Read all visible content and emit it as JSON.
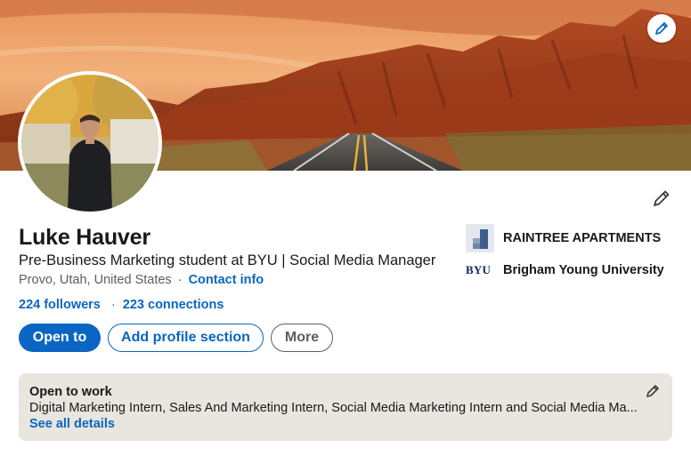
{
  "profile": {
    "name": "Luke Hauver",
    "headline": "Pre-Business Marketing student at BYU | Social Media Manager",
    "location": "Provo, Utah, United States",
    "location_separator": "·",
    "contact_info_label": "Contact info",
    "followers_label": "224 followers",
    "connections_label": "223 connections",
    "network_separator": "·"
  },
  "actions": {
    "open_to_label": "Open to",
    "add_section_label": "Add profile section",
    "more_label": "More"
  },
  "organizations": [
    {
      "name": "RAINTREE APARTMENTS",
      "logo": "raintree-logo"
    },
    {
      "name": "Brigham Young University",
      "logo_text": "BYU"
    }
  ],
  "open_to_work": {
    "title": "Open to work",
    "description": "Digital Marketing Intern, Sales And Marketing Intern, Social Media Marketing Intern and Social Media Ma...",
    "see_all_label": "See all details"
  },
  "icons": {
    "banner_edit": "pencil-icon",
    "intro_edit": "pencil-icon",
    "otw_edit": "pencil-icon"
  },
  "colors": {
    "brand_blue": "#0a66c2",
    "text_primary": "#191919",
    "text_secondary": "#5e5e5e",
    "card_background": "#e9e5df"
  }
}
